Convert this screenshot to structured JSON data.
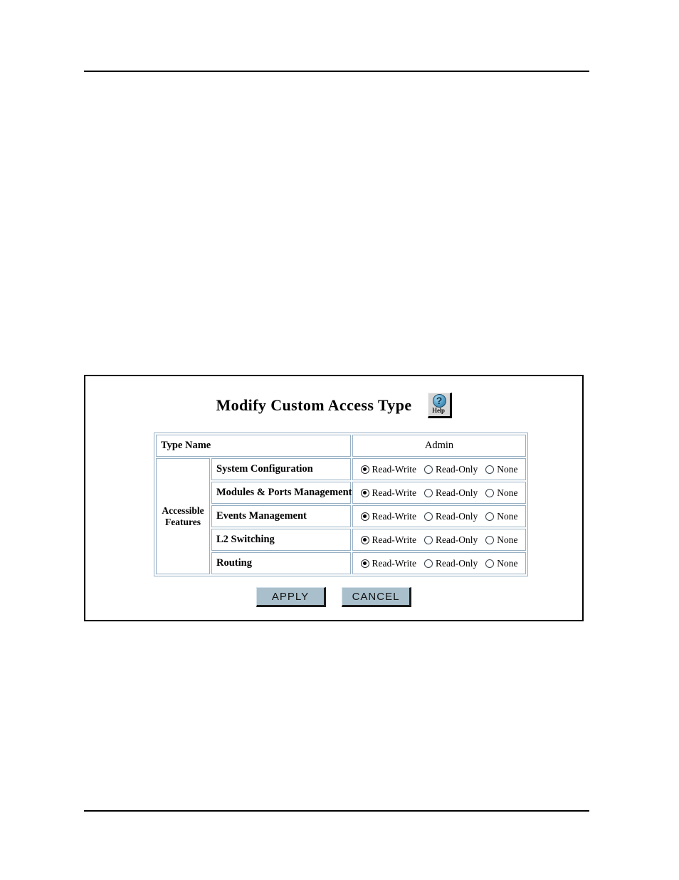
{
  "page": {
    "rule_top": "",
    "rule_bottom": ""
  },
  "panel": {
    "title": "Modify Custom Access Type",
    "help_icon": {
      "glyph": "?",
      "label": "Help",
      "name": "help-icon"
    }
  },
  "table": {
    "type_name_label": "Type Name",
    "admin_header": "Admin",
    "accessible_features_label_line1": "Accessible",
    "accessible_features_label_line2": "Features",
    "options": [
      "Read-Write",
      "Read-Only",
      "None"
    ],
    "rows": [
      {
        "feature": "System Configuration",
        "selected": "Read-Write"
      },
      {
        "feature": "Modules & Ports Management",
        "selected": "Read-Write"
      },
      {
        "feature": "Events Management",
        "selected": "Read-Write"
      },
      {
        "feature": "L2 Switching",
        "selected": "Read-Write"
      },
      {
        "feature": "Routing",
        "selected": "Read-Write"
      }
    ]
  },
  "buttons": {
    "apply": "APPLY",
    "cancel": "CANCEL"
  },
  "colors": {
    "button_face": "#a9bfcb",
    "table_border": "#97b0c4",
    "frame": "#000000",
    "help_ball": "#5fa8cf"
  }
}
